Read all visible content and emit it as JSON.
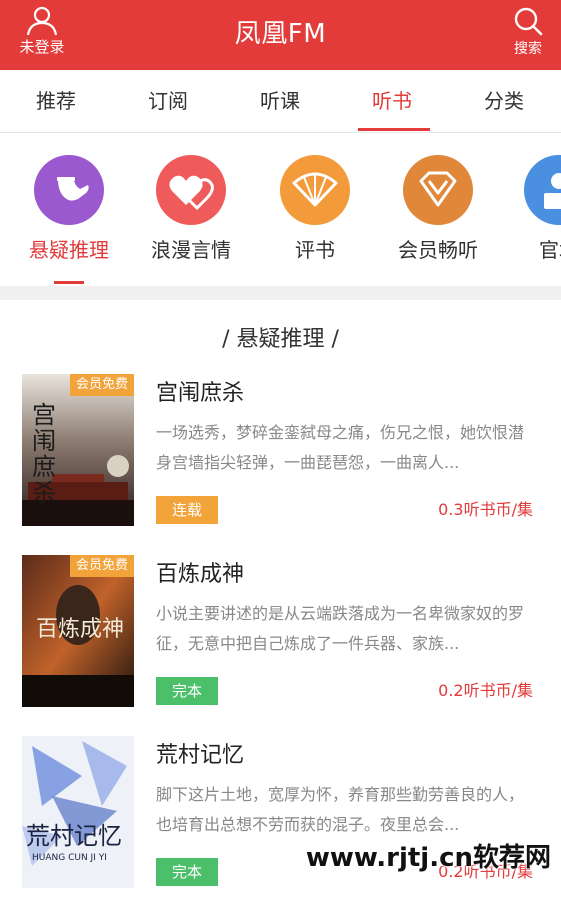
{
  "header": {
    "login_label": "未登录",
    "title": "凤凰FM",
    "search_label": "搜索",
    "background": "#e33a3a"
  },
  "tabs": [
    {
      "label": "推荐"
    },
    {
      "label": "订阅"
    },
    {
      "label": "听课"
    },
    {
      "label": "听书",
      "active": true
    },
    {
      "label": "分类"
    }
  ],
  "categories": [
    {
      "label": "悬疑推理",
      "icon": "pipe-icon",
      "color": "#9b59d0",
      "active": true
    },
    {
      "label": "浪漫言情",
      "icon": "hearts-icon",
      "color": "#ef5a5a"
    },
    {
      "label": "评书",
      "icon": "fan-icon",
      "color": "#f39a3a"
    },
    {
      "label": "会员畅听",
      "icon": "vip-diamond-icon",
      "color": "#e0873a"
    },
    {
      "label": "官场",
      "icon": "building-icon",
      "color": "#4a8fe0"
    }
  ],
  "section": {
    "title": "/ 悬疑推理 /"
  },
  "books": [
    {
      "title": "宫闱庶杀",
      "badge": "会员免费",
      "description": "一场选秀，梦碎金銮弑母之痛，伤兄之恨，她饮恨潜身宫墙指尖轻弹，一曲琵琶怨，一曲离人...",
      "status": "连载",
      "status_color": "#f2a33a",
      "price": "0.3听书币/集",
      "cover_text": "宫闱庶杀"
    },
    {
      "title": "百炼成神",
      "badge": "会员免费",
      "description": "小说主要讲述的是从云端跌落成为一名卑微家奴的罗征，无意中把自己炼成了一件兵器、家族...",
      "status": "完本",
      "status_color": "#4cbf6a",
      "price": "0.2听书币/集",
      "cover_text": "百炼成神"
    },
    {
      "title": "荒村记忆",
      "description": "脚下这片土地，宽厚为怀，养育那些勤劳善良的人，也培育出总想不劳而获的混子。夜里总会...",
      "status": "完本",
      "status_color": "#4cbf6a",
      "price": "0.2听书币/集",
      "cover_text": "荒村记忆",
      "cover_subtext": "HUANG CUN JI YI"
    }
  ],
  "watermark": "www.rjtj.cn软荐网"
}
